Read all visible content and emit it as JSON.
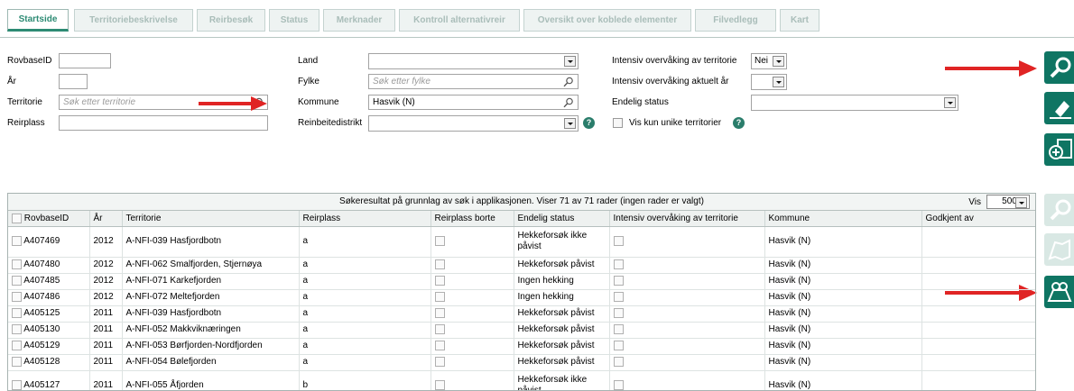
{
  "tabs": [
    {
      "label": "Startside",
      "active": true
    },
    {
      "label": "Territoriebeskrivelse",
      "active": false
    },
    {
      "label": "Reirbesøk",
      "active": false
    },
    {
      "label": "Status",
      "active": false
    },
    {
      "label": "Merknader",
      "active": false
    },
    {
      "label": "Kontroll alternativreir",
      "active": false
    },
    {
      "label": "Oversikt over koblede elementer",
      "active": false
    },
    {
      "label": "Filvedlegg",
      "active": false
    },
    {
      "label": "Kart",
      "active": false
    }
  ],
  "form": {
    "rovbaseid_label": "RovbaseID",
    "rovbaseid_value": "",
    "ar_label": "År",
    "ar_value": "",
    "territorie_label": "Territorie",
    "territorie_placeholder": "Søk etter territorie",
    "reirplass_label": "Reirplass",
    "reirplass_value": "",
    "land_label": "Land",
    "land_value": "",
    "fylke_label": "Fylke",
    "fylke_placeholder": "Søk etter fylke",
    "kommune_label": "Kommune",
    "kommune_value": "Hasvik (N)",
    "reinbeite_label": "Reinbeitedistrikt",
    "reinbeite_value": "",
    "intensiv_label": "Intensiv overvåking av territorie",
    "intensiv_value": "Nei",
    "intensiv_ar_label": "Intensiv overvåking aktuelt år",
    "intensiv_ar_value": "",
    "endelig_label": "Endelig status",
    "endelig_value": "",
    "unike_label": "Vis kun unike territorier",
    "help_glyph": "?"
  },
  "results": {
    "caption": "Søkeresultat på grunnlag av søk i applikasjonen. Viser 71 av 71 rader (ingen rader er valgt)",
    "vis_label": "Vis",
    "vis_value": "500",
    "columns": [
      "RovbaseID",
      "År",
      "Territorie",
      "Reirplass",
      "Reirplass borte",
      "Endelig status",
      "Intensiv overvåking av territorie",
      "Kommune",
      "Godkjent av"
    ],
    "rows": [
      {
        "id": "A407469",
        "year": "2012",
        "territorie": "A-NFI-039 Hasfjordbotn",
        "reirplass": "a",
        "status": "Hekkeforsøk ikke påvist",
        "kommune": "Hasvik (N)"
      },
      {
        "id": "A407480",
        "year": "2012",
        "territorie": "A-NFI-062 Smalfjorden, Stjernøya",
        "reirplass": "a",
        "status": "Hekkeforsøk påvist",
        "kommune": "Hasvik (N)"
      },
      {
        "id": "A407485",
        "year": "2012",
        "territorie": "A-NFI-071 Karkefjorden",
        "reirplass": "a",
        "status": "Ingen hekking",
        "kommune": "Hasvik (N)"
      },
      {
        "id": "A407486",
        "year": "2012",
        "territorie": "A-NFI-072 Meltefjorden",
        "reirplass": "a",
        "status": "Ingen hekking",
        "kommune": "Hasvik (N)"
      },
      {
        "id": "A405125",
        "year": "2011",
        "territorie": "A-NFI-039 Hasfjordbotn",
        "reirplass": "a",
        "status": "Hekkeforsøk påvist",
        "kommune": "Hasvik (N)"
      },
      {
        "id": "A405130",
        "year": "2011",
        "territorie": "A-NFI-052 Makkviknæringen",
        "reirplass": "a",
        "status": "Hekkeforsøk påvist",
        "kommune": "Hasvik (N)"
      },
      {
        "id": "A405129",
        "year": "2011",
        "territorie": "A-NFI-053 Børfjorden-Nordfjorden",
        "reirplass": "a",
        "status": "Hekkeforsøk påvist",
        "kommune": "Hasvik (N)"
      },
      {
        "id": "A405128",
        "year": "2011",
        "territorie": "A-NFI-054 Bølefjorden",
        "reirplass": "a",
        "status": "Hekkeforsøk påvist",
        "kommune": "Hasvik (N)"
      },
      {
        "id": "A405127",
        "year": "2011",
        "territorie": "A-NFI-055 Åfjorden",
        "reirplass": "b",
        "status": "Hekkeforsøk ikke påvist",
        "kommune": "Hasvik (N)"
      }
    ]
  },
  "colors": {
    "accent": "#2d8b74",
    "tool_active": "#0f7563",
    "tool_inactive": "#d9e8e4",
    "arrow": "#e02424"
  },
  "tools": [
    "search-icon",
    "eraser-icon",
    "add-document-icon",
    "zoom-map-icon",
    "map-icon",
    "map-pins-icon"
  ]
}
